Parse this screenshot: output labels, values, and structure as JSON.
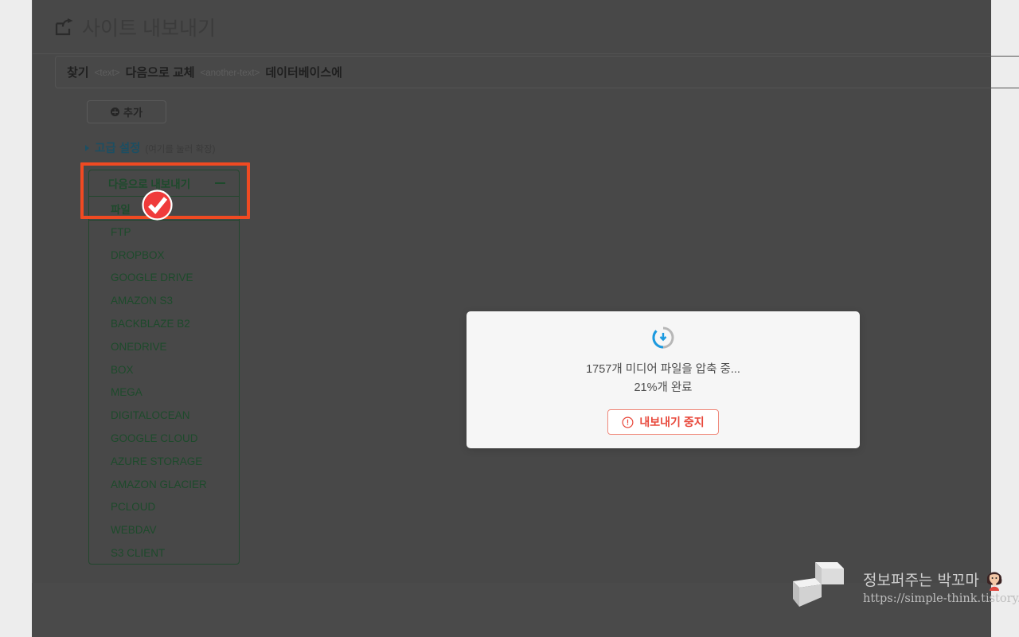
{
  "header": {
    "title": "사이트 내보내기",
    "icon": "export-share-icon"
  },
  "find_replace": {
    "find_label": "찾기",
    "find_token": "<text>",
    "replace_label": "다음으로 교체",
    "replace_token": "<another-text>",
    "scope_label": "데이터베이스에"
  },
  "toolbar": {
    "add_label": "추가",
    "add_icon": "plus-circle-icon"
  },
  "advanced": {
    "label": "고급 설정",
    "hint": "(여기를 눌러 확장)",
    "caret_icon": "caret-right-icon"
  },
  "destinations": {
    "header_label": "다음으로 내보내기",
    "collapse_icon": "minus-icon",
    "items": [
      "파일",
      "FTP",
      "DROPBOX",
      "GOOGLE DRIVE",
      "AMAZON S3",
      "BACKBLAZE B2",
      "ONEDRIVE",
      "BOX",
      "MEGA",
      "DIGITALOCEAN",
      "GOOGLE CLOUD",
      "AZURE STORAGE",
      "AMAZON GLACIER",
      "PCLOUD",
      "WEBDAV",
      "S3 CLIENT"
    ],
    "selected": "파일",
    "annotation_color": "#f04a22",
    "cursor_icon": "check-circle-badge-icon"
  },
  "modal": {
    "spinner_icon": "loading-spinner-icon",
    "message": "1757개 미디어 파일을 압축 중...",
    "progress_text": "21%개 완료",
    "progress_percent": 21,
    "file_count": 1757,
    "stop_button_label": "내보내기 중지",
    "stop_button_icon": "exclamation-circle-icon",
    "stop_button_color": "#e8473a"
  },
  "watermark": {
    "logo_icon": "3d-block-logo",
    "name": "정보퍼주는 박꼬마",
    "avatar_icon": "girl-avatar-icon",
    "url": "https://simple-think.tistory.com/"
  }
}
